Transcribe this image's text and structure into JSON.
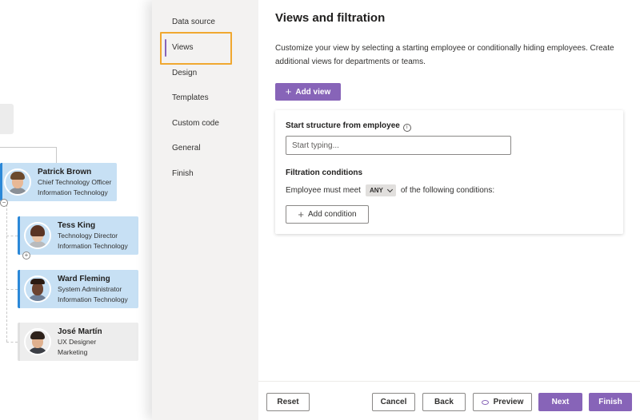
{
  "org_chart": {
    "people": [
      {
        "name": "Patrick Brown",
        "title": "Chief Technology Officer",
        "department": "Information Technology",
        "skin": "#e8b896",
        "hair": "#6b4a2e",
        "shirt": "#8a8f96"
      },
      {
        "name": "Tess King",
        "title": "Technology Director",
        "department": "Information Technology",
        "skin": "#e9c3a6",
        "hair": "#5a3424",
        "shirt": "#b8babd"
      },
      {
        "name": "Ward Fleming",
        "title": "System Administrator",
        "department": "Information Technology",
        "skin": "#6b4330",
        "hair": "#2a1a12",
        "shirt": "#6d7e96"
      },
      {
        "name": "José Martín",
        "title": "UX Designer",
        "department": "Marketing",
        "skin": "#dfb08e",
        "hair": "#2e221c",
        "shirt": "#3c3f46"
      }
    ]
  },
  "nav": {
    "items": [
      "Data source",
      "Views",
      "Design",
      "Templates",
      "Custom code",
      "General",
      "Finish"
    ],
    "active": "Views"
  },
  "main": {
    "title": "Views and filtration",
    "description": "Customize your view by selecting a starting employee or conditionally hiding employees. Create additional views for departments or teams.",
    "add_view_label": "Add view",
    "start_structure_label": "Start structure from employee",
    "start_input_placeholder": "Start typing...",
    "filtration_title": "Filtration conditions",
    "condition_prefix": "Employee must meet",
    "condition_mode": "ANY",
    "condition_suffix": "of the following conditions:",
    "add_condition_label": "Add condition"
  },
  "footer": {
    "reset": "Reset",
    "cancel": "Cancel",
    "back": "Back",
    "preview": "Preview",
    "next": "Next",
    "finish": "Finish"
  },
  "colors": {
    "accent": "#8764b8",
    "highlight_box": "#f0a830",
    "card_blue": "#c7e0f4",
    "card_border": "#2b88d8"
  }
}
